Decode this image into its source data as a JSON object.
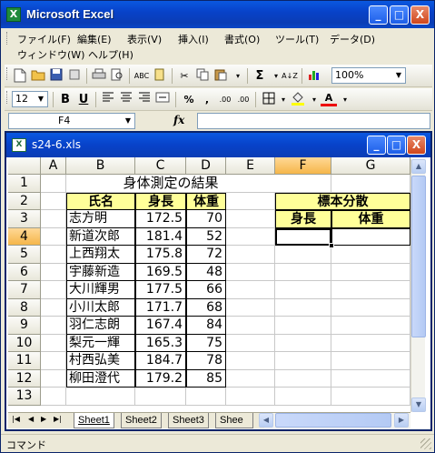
{
  "app": {
    "title": "Microsoft Excel",
    "window_buttons": [
      "_",
      "□",
      "X"
    ]
  },
  "menu": {
    "items": [
      "ファイル(F)",
      "編集(E)",
      "表示(V)",
      "挿入(I)",
      "書式(O)",
      "ツール(T)",
      "データ(D)"
    ],
    "items_row2": [
      "ウィンドウ(W)",
      "ヘルプ(H)"
    ]
  },
  "toolbar": {
    "zoom": "100%",
    "font_size": "12",
    "bold": "B",
    "underline": "U",
    "percent": "%",
    "comma": ",",
    "increase_decimal": ".00",
    "decrease_decimal": ".00",
    "sigma": "Σ",
    "sort": "A↓Z",
    "font_color_label": "A"
  },
  "formula_bar": {
    "name_box": "F4",
    "fx": "fx",
    "formula": ""
  },
  "workbook": {
    "title": "s24-6.xls",
    "columns": [
      "A",
      "B",
      "C",
      "D",
      "E",
      "F",
      "G"
    ],
    "rows": [
      "1",
      "2",
      "3",
      "4",
      "5",
      "6",
      "7",
      "8",
      "9",
      "10",
      "11",
      "12",
      "13"
    ],
    "sheet_title": "身体測定の結果",
    "table_headers": [
      "氏名",
      "身長",
      "体重"
    ],
    "people": [
      {
        "name": "志方明",
        "height": "172.5",
        "weight": "70"
      },
      {
        "name": "新道次郎",
        "height": "181.4",
        "weight": "52"
      },
      {
        "name": "上西翔太",
        "height": "175.8",
        "weight": "72"
      },
      {
        "name": "宇藤新造",
        "height": "169.5",
        "weight": "48"
      },
      {
        "name": "大川輝男",
        "height": "177.5",
        "weight": "66"
      },
      {
        "name": "小川太郎",
        "height": "171.7",
        "weight": "68"
      },
      {
        "name": "羽仁志朗",
        "height": "167.4",
        "weight": "84"
      },
      {
        "name": "梨元一輝",
        "height": "165.3",
        "weight": "75"
      },
      {
        "name": "村西弘美",
        "height": "184.7",
        "weight": "78"
      },
      {
        "name": "柳田澄代",
        "height": "179.2",
        "weight": "85"
      }
    ],
    "stdev_title": "標本分散",
    "stdev_headers": [
      "身長",
      "体重"
    ],
    "selected_cell": "F4"
  },
  "sheets": [
    "Sheet1",
    "Sheet2",
    "Sheet3",
    "Shee"
  ],
  "status": {
    "text": "コマンド"
  },
  "colors": {
    "title_blue": "#0842c9",
    "highlight_yellow": "#ffff99",
    "selected_header": "#f5b64a"
  }
}
